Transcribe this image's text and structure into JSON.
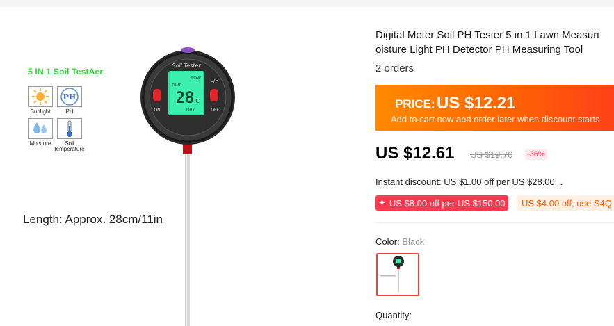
{
  "product": {
    "title": "Digital Meter Soil PH Tester 5 in 1 Lawn Measuri\noisture Light PH Detector PH Measuring Tool",
    "orders": "2 orders"
  },
  "gallery": {
    "badge": "5 IN 1 Soil TestAer",
    "features": [
      "Sunlight",
      "PH",
      "Moisture",
      "Soil\ntemperature"
    ],
    "ph_text": "PH",
    "length_text": "Length: Approx. 28cm/11in",
    "device": {
      "brand_text": "Soil Tester",
      "left_button": "ON",
      "right_button": "OFF",
      "unit_switch": "C/F",
      "lcd_top": "LOW",
      "lcd_temp": "TEMP",
      "lcd_value": "28",
      "lcd_unit": "C",
      "lcd_bottom": "DRY"
    }
  },
  "price": {
    "label": "PRICE:",
    "value": "US $12.21",
    "note": "Add to cart now and order later when discount starts",
    "current": "US $12.61",
    "original": "US $19.70",
    "discount": "-36%"
  },
  "promo": {
    "instant": "Instant discount: US $1.00 off per US $28.00",
    "coupon1": "US $8.00 off per US $150.00",
    "coupon2": "US $4.00 off, use S4Q"
  },
  "options": {
    "color_label": "Color:",
    "color_value": "Black",
    "quantity_label": "Quantity:"
  },
  "colors": {
    "accent_red": "#fd384f",
    "orange": "#ff6a00",
    "lcd_green": "#2ee8a4",
    "feature_green": "#1fdd2b"
  }
}
